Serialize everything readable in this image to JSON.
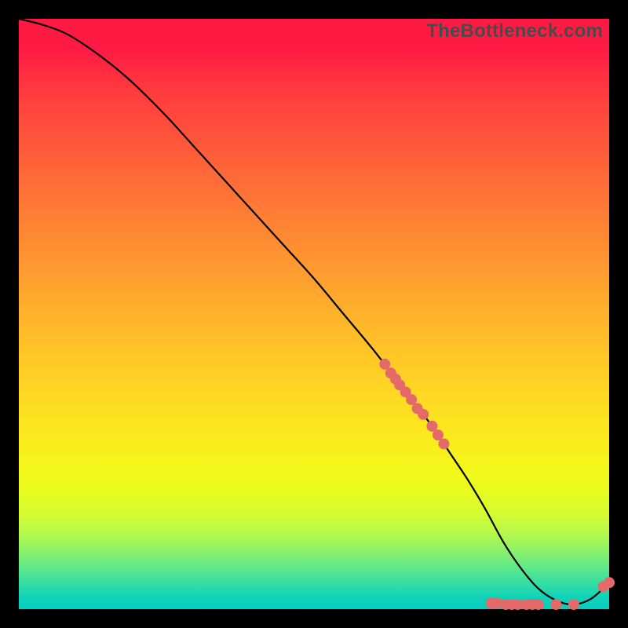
{
  "watermark": "TheBottleneck.com",
  "colors": {
    "background": "#000000",
    "curve_stroke": "#000000",
    "marker_fill": "#e46a6a",
    "marker_stroke": "#b34d4d"
  },
  "chart_data": {
    "type": "line",
    "title": "",
    "xlabel": "",
    "ylabel": "",
    "xlim": [
      0,
      100
    ],
    "ylim": [
      0,
      100
    ],
    "grid": false,
    "legend": false,
    "series": [
      {
        "name": "curve",
        "x": [
          0,
          4,
          8,
          12,
          16,
          20,
          25,
          30,
          35,
          40,
          45,
          50,
          55,
          60,
          65,
          70,
          73,
          76,
          79,
          82,
          85,
          88,
          91,
          94,
          97,
          100
        ],
        "y": [
          100,
          99,
          97.5,
          95,
          92,
          88.5,
          83.5,
          78,
          72.5,
          67,
          61.5,
          56,
          50,
          44,
          37.5,
          31,
          26.5,
          22,
          17,
          11.5,
          7,
          3.5,
          1.5,
          0.8,
          1.8,
          4.5
        ]
      }
    ],
    "markers": [
      {
        "x": 62.0,
        "y": 41.5
      },
      {
        "x": 63.0,
        "y": 40.0
      },
      {
        "x": 63.8,
        "y": 39.0
      },
      {
        "x": 64.5,
        "y": 38.0
      },
      {
        "x": 65.5,
        "y": 36.8
      },
      {
        "x": 66.5,
        "y": 35.5
      },
      {
        "x": 67.5,
        "y": 34.0
      },
      {
        "x": 68.5,
        "y": 33.0
      },
      {
        "x": 70.0,
        "y": 31.0
      },
      {
        "x": 71.0,
        "y": 29.5
      },
      {
        "x": 72.0,
        "y": 28.0
      },
      {
        "x": 80.0,
        "y": 1.0
      },
      {
        "x": 81.0,
        "y": 1.0
      },
      {
        "x": 82.5,
        "y": 0.8
      },
      {
        "x": 83.5,
        "y": 0.8
      },
      {
        "x": 84.5,
        "y": 0.8
      },
      {
        "x": 86.0,
        "y": 0.8
      },
      {
        "x": 87.0,
        "y": 0.8
      },
      {
        "x": 88.0,
        "y": 0.8
      },
      {
        "x": 91.0,
        "y": 0.8
      },
      {
        "x": 94.0,
        "y": 0.8
      },
      {
        "x": 99.0,
        "y": 3.8
      },
      {
        "x": 100.0,
        "y": 4.5
      }
    ]
  }
}
